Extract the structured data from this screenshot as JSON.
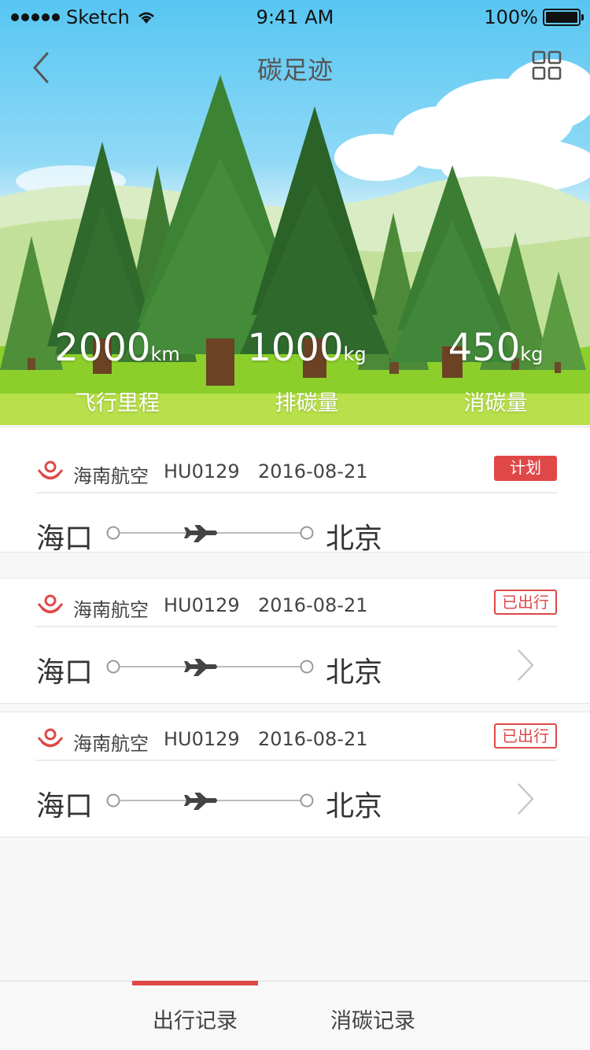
{
  "status_bar": {
    "carrier": "Sketch",
    "time": "9:41 AM",
    "battery": "100%"
  },
  "nav": {
    "title": "碳足迹"
  },
  "stats": [
    {
      "value": "2000",
      "unit": "km",
      "label": "飞行里程"
    },
    {
      "value": "1000",
      "unit": "kg",
      "label": "排碳量"
    },
    {
      "value": "450",
      "unit": "kg",
      "label": "消碳量"
    }
  ],
  "flights": [
    {
      "airline": "海南航空",
      "flight_no": "HU0129",
      "date": "2016-08-21",
      "status": "计划",
      "from": "海口",
      "to": "北京"
    },
    {
      "airline": "海南航空",
      "flight_no": "HU0129",
      "date": "2016-08-21",
      "status": "已出行",
      "from": "海口",
      "to": "北京"
    },
    {
      "airline": "海南航空",
      "flight_no": "HU0129",
      "date": "2016-08-21",
      "status": "已出行",
      "from": "海口",
      "to": "北京"
    }
  ],
  "tabs": [
    {
      "label": "出行记录",
      "active": true
    },
    {
      "label": "消碳记录",
      "active": false
    }
  ],
  "colors": {
    "accent": "#e04848",
    "sky": "#57c6f2",
    "grass": "#8ccf2a"
  }
}
